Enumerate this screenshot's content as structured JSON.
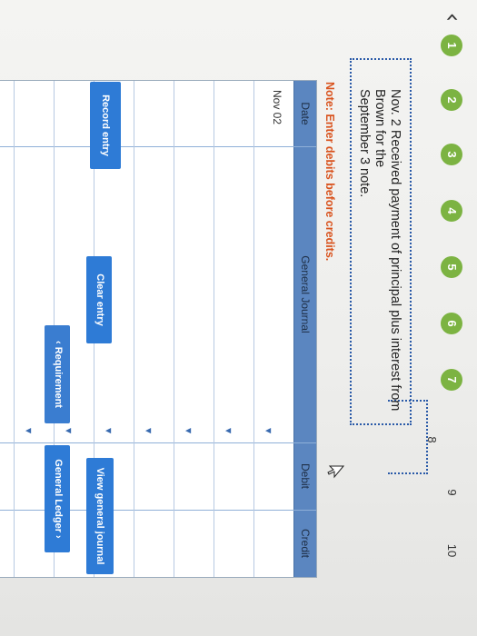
{
  "nav": {
    "back_glyph": "‹",
    "steps": [
      "1",
      "2",
      "3",
      "4",
      "5",
      "6",
      "7",
      "8",
      "9",
      "10"
    ],
    "active_step": "8"
  },
  "prompt": {
    "line1": "Nov. 2 Received payment of principal plus interest from Brown for the",
    "line2": "September 3 note."
  },
  "note": "Note: Enter debits before credits.",
  "journal": {
    "headers": {
      "date": "Date",
      "account": "General Journal",
      "debit": "Debit",
      "credit": "Credit"
    },
    "rows": [
      {
        "date": "Nov 02",
        "account": "",
        "debit": "",
        "credit": ""
      },
      {
        "date": "",
        "account": "",
        "debit": "",
        "credit": ""
      },
      {
        "date": "",
        "account": "",
        "debit": "",
        "credit": ""
      },
      {
        "date": "",
        "account": "",
        "debit": "",
        "credit": ""
      },
      {
        "date": "",
        "account": "",
        "debit": "",
        "credit": ""
      },
      {
        "date": "",
        "account": "",
        "debit": "",
        "credit": ""
      },
      {
        "date": "",
        "account": "",
        "debit": "",
        "credit": ""
      }
    ]
  },
  "buttons": {
    "record_entry": "Record entry",
    "clear_entry": "Clear entry",
    "view_general_journal": "View general journal",
    "requirement": "‹  Requirement",
    "general_ledger": "General Ledger  ›"
  },
  "colors": {
    "step_done": "#7cb342",
    "accent": "#2e7bd6",
    "note": "#d9531e"
  }
}
